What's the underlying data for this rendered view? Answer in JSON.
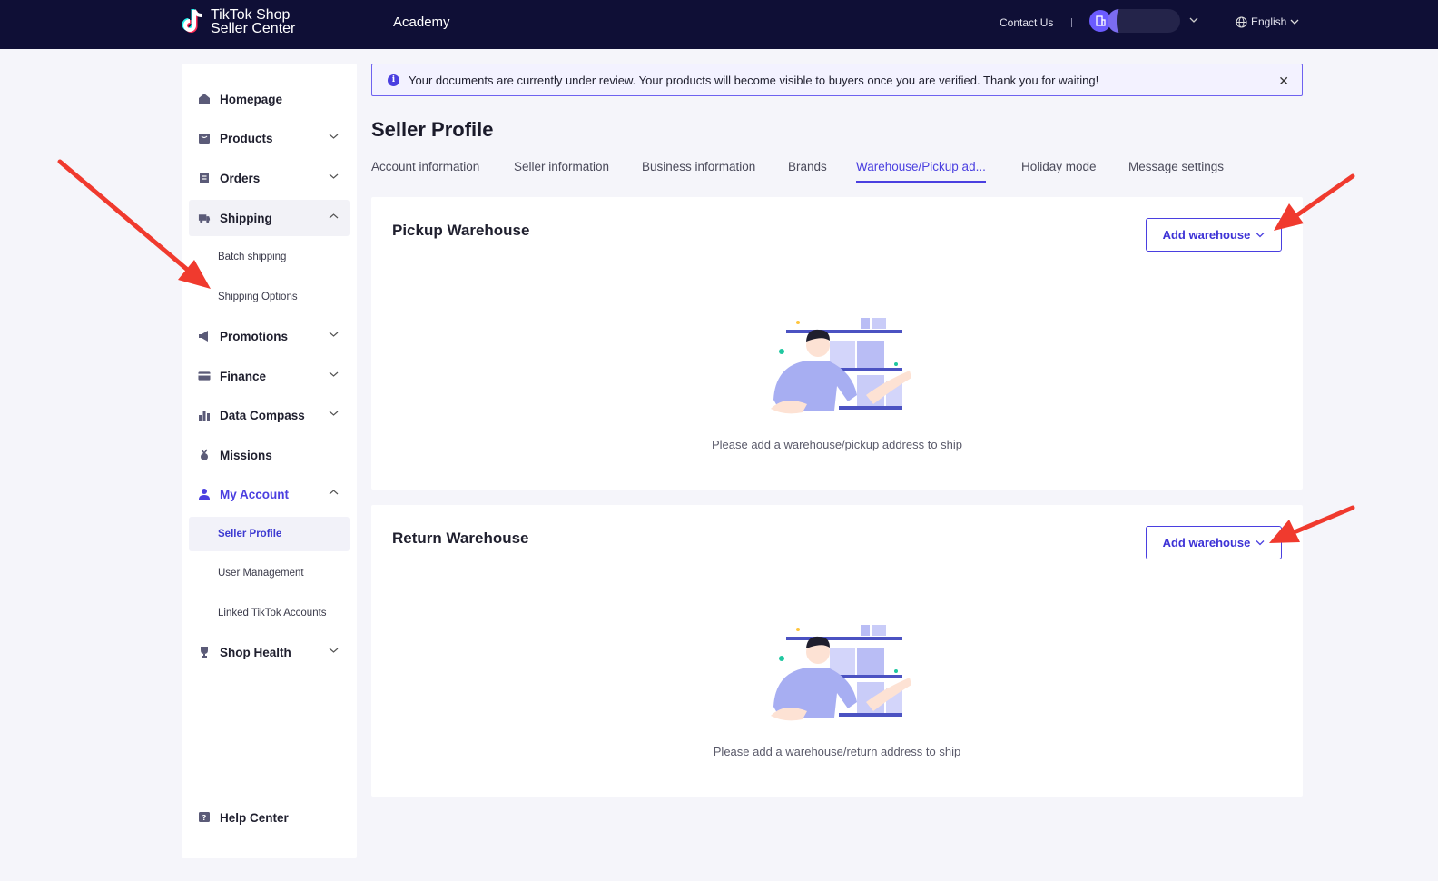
{
  "topbar": {
    "brand_line1": "TikTok",
    "brand_line1_suffix": " Shop",
    "brand_line2": "Seller Center",
    "academy": "Academy",
    "contact": "Contact Us",
    "language": "English"
  },
  "sidebar": {
    "items": [
      {
        "label": "Homepage",
        "icon": "home-icon"
      },
      {
        "label": "Products",
        "icon": "bag-icon"
      },
      {
        "label": "Orders",
        "icon": "orders-icon"
      },
      {
        "label": "Shipping",
        "icon": "truck-icon"
      },
      {
        "label": "Batch shipping"
      },
      {
        "label": "Shipping Options"
      },
      {
        "label": "Promotions",
        "icon": "megaphone-icon"
      },
      {
        "label": "Finance",
        "icon": "card-icon"
      },
      {
        "label": "Data Compass",
        "icon": "chart-icon"
      },
      {
        "label": "Missions",
        "icon": "medal-icon"
      },
      {
        "label": "My Account",
        "icon": "person-icon"
      },
      {
        "label": "Seller Profile"
      },
      {
        "label": "User Management"
      },
      {
        "label": "Linked TikTok Accounts"
      },
      {
        "label": "Shop Health",
        "icon": "trophy-icon"
      },
      {
        "label": "Help Center",
        "icon": "help-icon"
      }
    ]
  },
  "notice": {
    "text": "Your documents are currently under review. Your products will become visible to buyers once you are verified. Thank you for waiting!"
  },
  "page": {
    "title": "Seller Profile",
    "tabs": [
      {
        "label": "Account information"
      },
      {
        "label": "Seller information"
      },
      {
        "label": "Business information"
      },
      {
        "label": "Brands"
      },
      {
        "label": "Warehouse/Pickup ad..."
      },
      {
        "label": "Holiday mode"
      },
      {
        "label": "Message settings"
      }
    ],
    "active_tab": "Warehouse/Pickup ad..."
  },
  "pickup": {
    "title": "Pickup Warehouse",
    "button": "Add warehouse",
    "empty": "Please add a warehouse/pickup address to ship"
  },
  "return": {
    "title": "Return Warehouse",
    "button": "Add warehouse",
    "empty": "Please add a warehouse/return address to ship"
  },
  "colors": {
    "topbar": "#0f0f36",
    "accent": "#4a3fe0",
    "annotation_arrow": "#f03a2e"
  }
}
